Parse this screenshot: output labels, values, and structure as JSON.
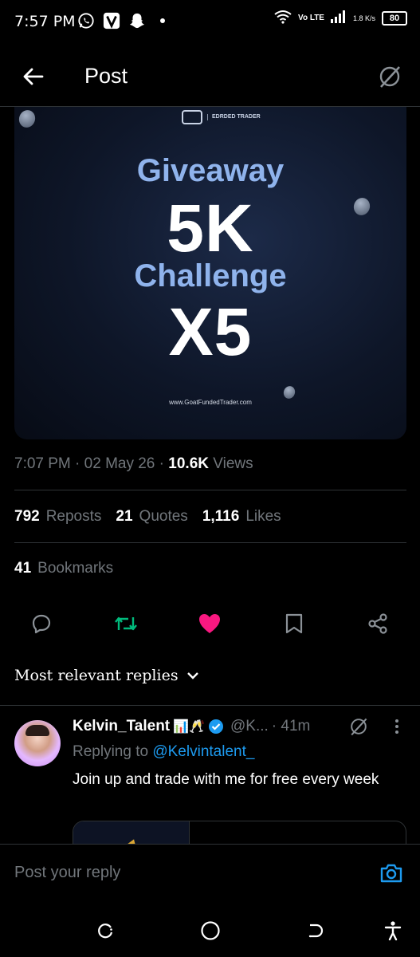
{
  "status_bar": {
    "time": "7:57 PM",
    "network": "Vo LTE",
    "speed": "1.8 K/s",
    "battery": "80"
  },
  "header": {
    "title": "Post"
  },
  "media": {
    "brand": "EDRDED TRADER",
    "line1": "Giveaway",
    "line2": "5K",
    "line3": "Challenge",
    "line4": "X5",
    "url": "www.GoatFundedTrader.com"
  },
  "meta": {
    "time": "7:07 PM",
    "date": "02 May 26",
    "views_count": "10.6K",
    "views_label": "Views"
  },
  "stats": {
    "reposts_count": "792",
    "reposts_label": "Reposts",
    "quotes_count": "21",
    "quotes_label": "Quotes",
    "likes_count": "1,116",
    "likes_label": "Likes",
    "bookmarks_count": "41",
    "bookmarks_label": "Bookmarks"
  },
  "colors": {
    "repost_active": "#00ba7c",
    "like_active": "#f91880",
    "link": "#1d9bf0",
    "muted": "#71767b"
  },
  "replies_filter": {
    "label": "Most relevant replies"
  },
  "reply": {
    "name": "Kelvin_Talent",
    "emoji": "📊🥂",
    "handle": "@K...",
    "time": "· 41m",
    "replying_prefix": "Replying to",
    "replying_handle": "@Kelvintalent_",
    "text": "Join up and trade with me for free every week"
  },
  "composer": {
    "placeholder": "Post your reply"
  }
}
